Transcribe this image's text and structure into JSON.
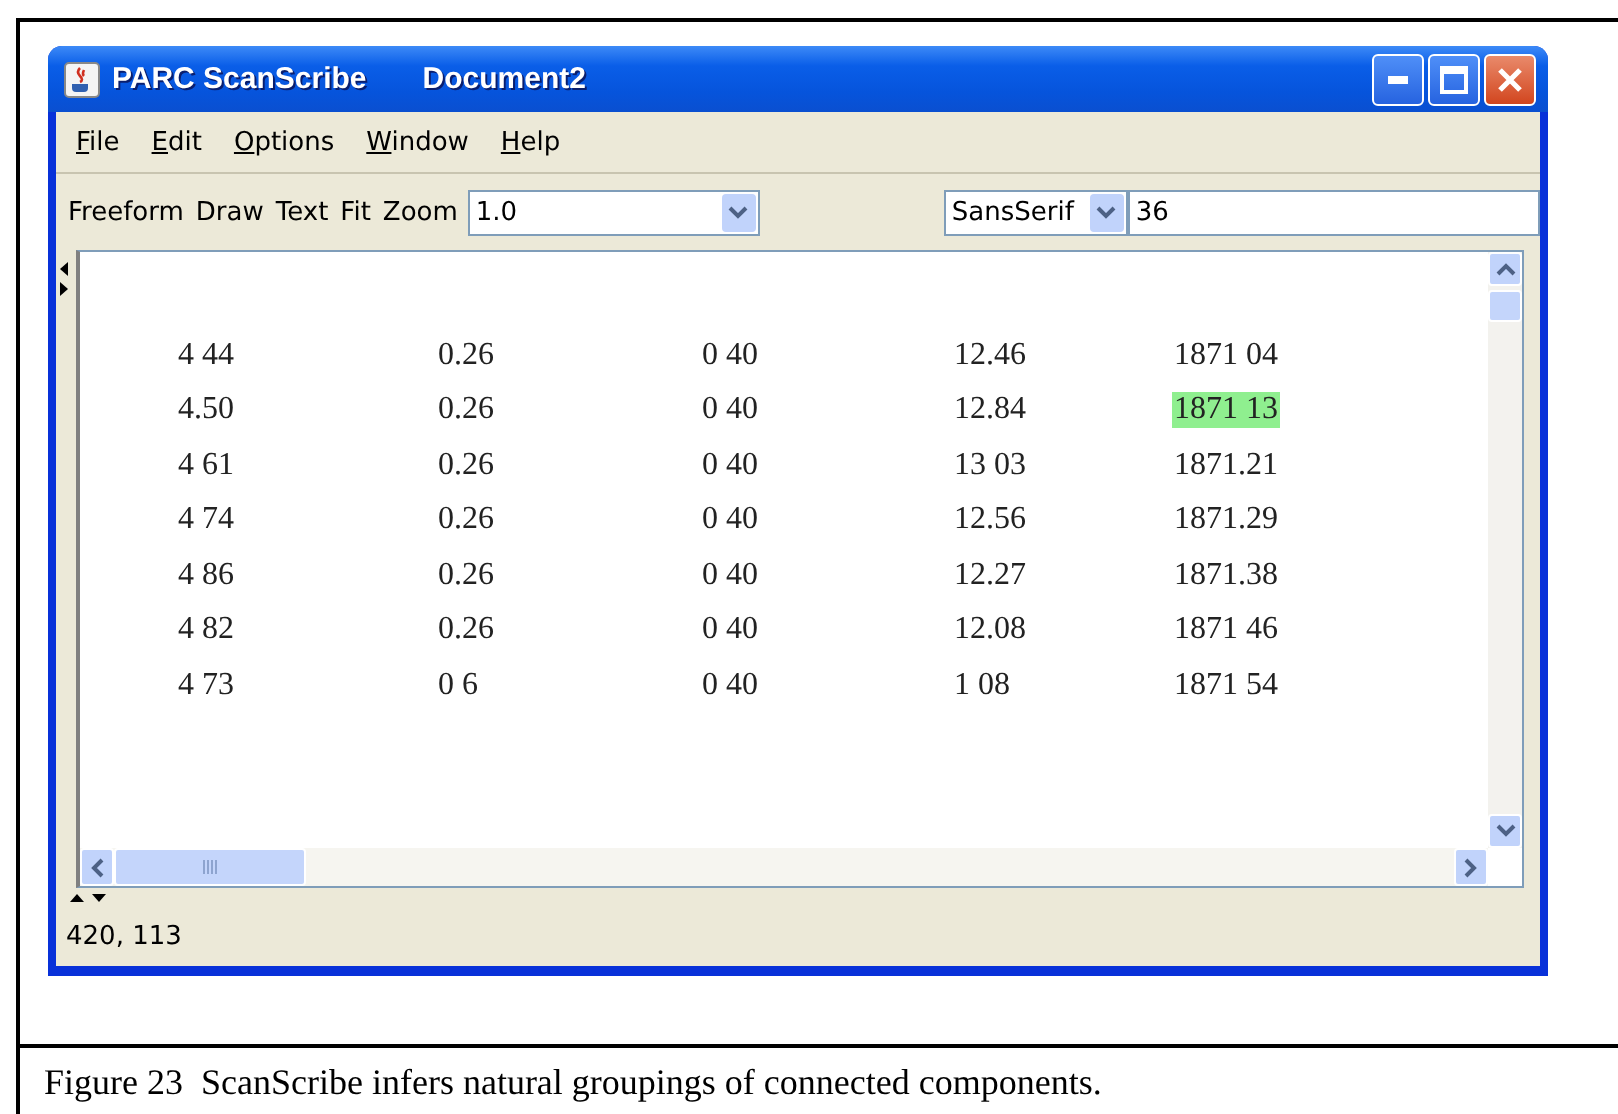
{
  "window": {
    "title": "PARC ScanScribe",
    "document": "Document2"
  },
  "menu": [
    {
      "label": "File"
    },
    {
      "label": "Edit"
    },
    {
      "label": "Options"
    },
    {
      "label": "Window"
    },
    {
      "label": "Help"
    }
  ],
  "toolbar": {
    "buttons": [
      "Freeform",
      "Draw",
      "Text",
      "Fit"
    ],
    "zoom_label": "Zoom",
    "zoom_value": "1.0",
    "font_value": "SansSerif",
    "size_value": "36"
  },
  "canvas": {
    "rows": [
      {
        "cells": [
          {
            "text": "4 44",
            "selected": false
          },
          {
            "text": "0.26",
            "selected": false
          },
          {
            "text": "0 40",
            "selected": false
          },
          {
            "text": "12.46",
            "selected": false
          },
          {
            "text": "1871 04",
            "selected": false
          }
        ]
      },
      {
        "cells": [
          {
            "text": "4.50",
            "selected": false
          },
          {
            "text": "0.26",
            "selected": false
          },
          {
            "text": "0 40",
            "selected": false
          },
          {
            "text": "12.84",
            "selected": false
          },
          {
            "text": "1871 13",
            "selected": true
          }
        ]
      },
      {
        "cells": [
          {
            "text": "4 61",
            "selected": false
          },
          {
            "text": "0.26",
            "selected": false
          },
          {
            "text": "0 40",
            "selected": false
          },
          {
            "text": "13 03",
            "selected": false
          },
          {
            "text": "1871.21",
            "selected": false
          }
        ]
      },
      {
        "cells": [
          {
            "text": "4 74",
            "selected": false
          },
          {
            "text": "0.26",
            "selected": false
          },
          {
            "text": "0 40",
            "selected": false
          },
          {
            "text": "12.56",
            "selected": false
          },
          {
            "text": "1871.29",
            "selected": false
          }
        ]
      },
      {
        "cells": [
          {
            "text": "4 86",
            "selected": false
          },
          {
            "text": "0.26",
            "selected": false
          },
          {
            "text": "0 40",
            "selected": false
          },
          {
            "text": "12.27",
            "selected": false
          },
          {
            "text": "1871.38",
            "selected": false
          }
        ]
      },
      {
        "cells": [
          {
            "text": "4 82",
            "selected": false
          },
          {
            "text": "0.26",
            "selected": false
          },
          {
            "text": "0 40",
            "selected": false
          },
          {
            "text": "12.08",
            "selected": false
          },
          {
            "text": "1871 46",
            "selected": false
          }
        ]
      },
      {
        "cells": [
          {
            "text": "4 73",
            "selected": false
          },
          {
            "text": "0 6",
            "selected": false
          },
          {
            "text": "0 40",
            "selected": false
          },
          {
            "text": "1 08",
            "selected": false
          },
          {
            "text": "1871 54",
            "selected": false
          }
        ]
      }
    ]
  },
  "status_bar": "420, 113",
  "caption": "Figure 23  ScanScribe infers natural groupings of connected components."
}
